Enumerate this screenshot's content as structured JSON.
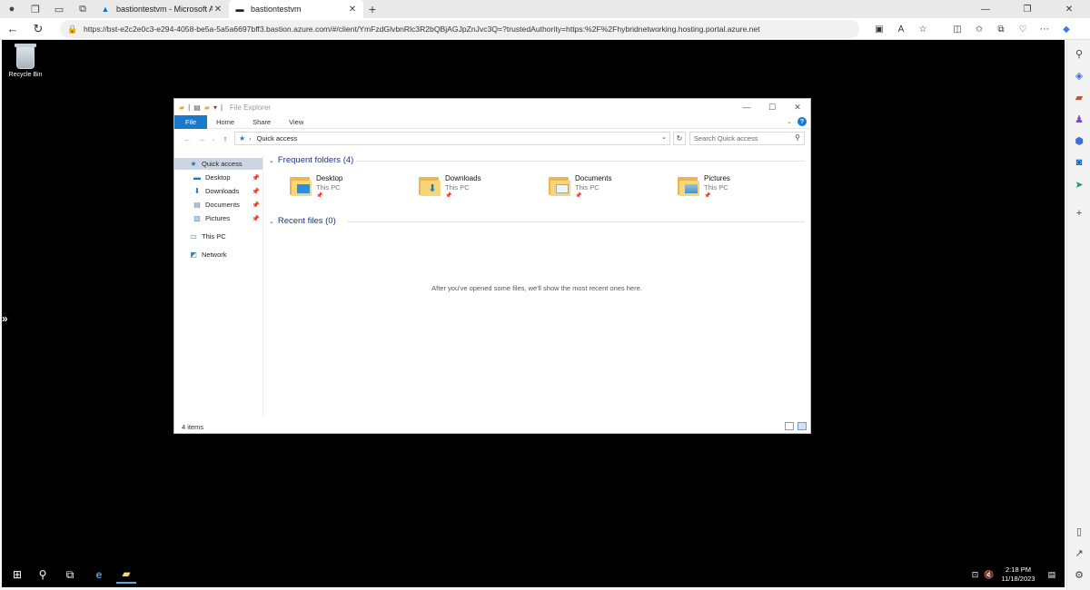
{
  "browser": {
    "tabs": [
      {
        "title": "bastiontestvm - Microsoft Azure",
        "active": false
      },
      {
        "title": "bastiontestvm",
        "active": true
      }
    ],
    "url": "https://bst-e2c2e0c3-e294-4058-be5a-5a5a6697bff3.bastion.azure.com/#/client/YmFzdGlvbnRlc3R2bQBjAGJpZnJvc3Q=?trustedAuthority=https:%2F%2Fhybridnetworking.hosting.portal.azure.net"
  },
  "desktop": {
    "recycle_bin_label": "Recycle Bin"
  },
  "explorer": {
    "title": "File Explorer",
    "ribbon_tabs": [
      "File",
      "Home",
      "Share",
      "View"
    ],
    "address": "Quick access",
    "search_placeholder": "Search Quick access",
    "nav": {
      "quick_access": "Quick access",
      "pinned": [
        "Desktop",
        "Downloads",
        "Documents",
        "Pictures"
      ],
      "this_pc": "This PC",
      "network": "Network"
    },
    "frequent_header": "Frequent folders (4)",
    "folders": [
      {
        "name": "Desktop",
        "location": "This PC"
      },
      {
        "name": "Downloads",
        "location": "This PC"
      },
      {
        "name": "Documents",
        "location": "This PC"
      },
      {
        "name": "Pictures",
        "location": "This PC"
      }
    ],
    "recent_header": "Recent files (0)",
    "recent_empty": "After you've opened some files, we'll show the most recent ones here.",
    "status": "4 items"
  },
  "taskbar": {
    "time": "2:18 PM",
    "date": "11/18/2023"
  },
  "colors": {
    "accent": "#1979ca",
    "desktop_bg": "#000000",
    "folder_yellow": "#f7d57b"
  }
}
